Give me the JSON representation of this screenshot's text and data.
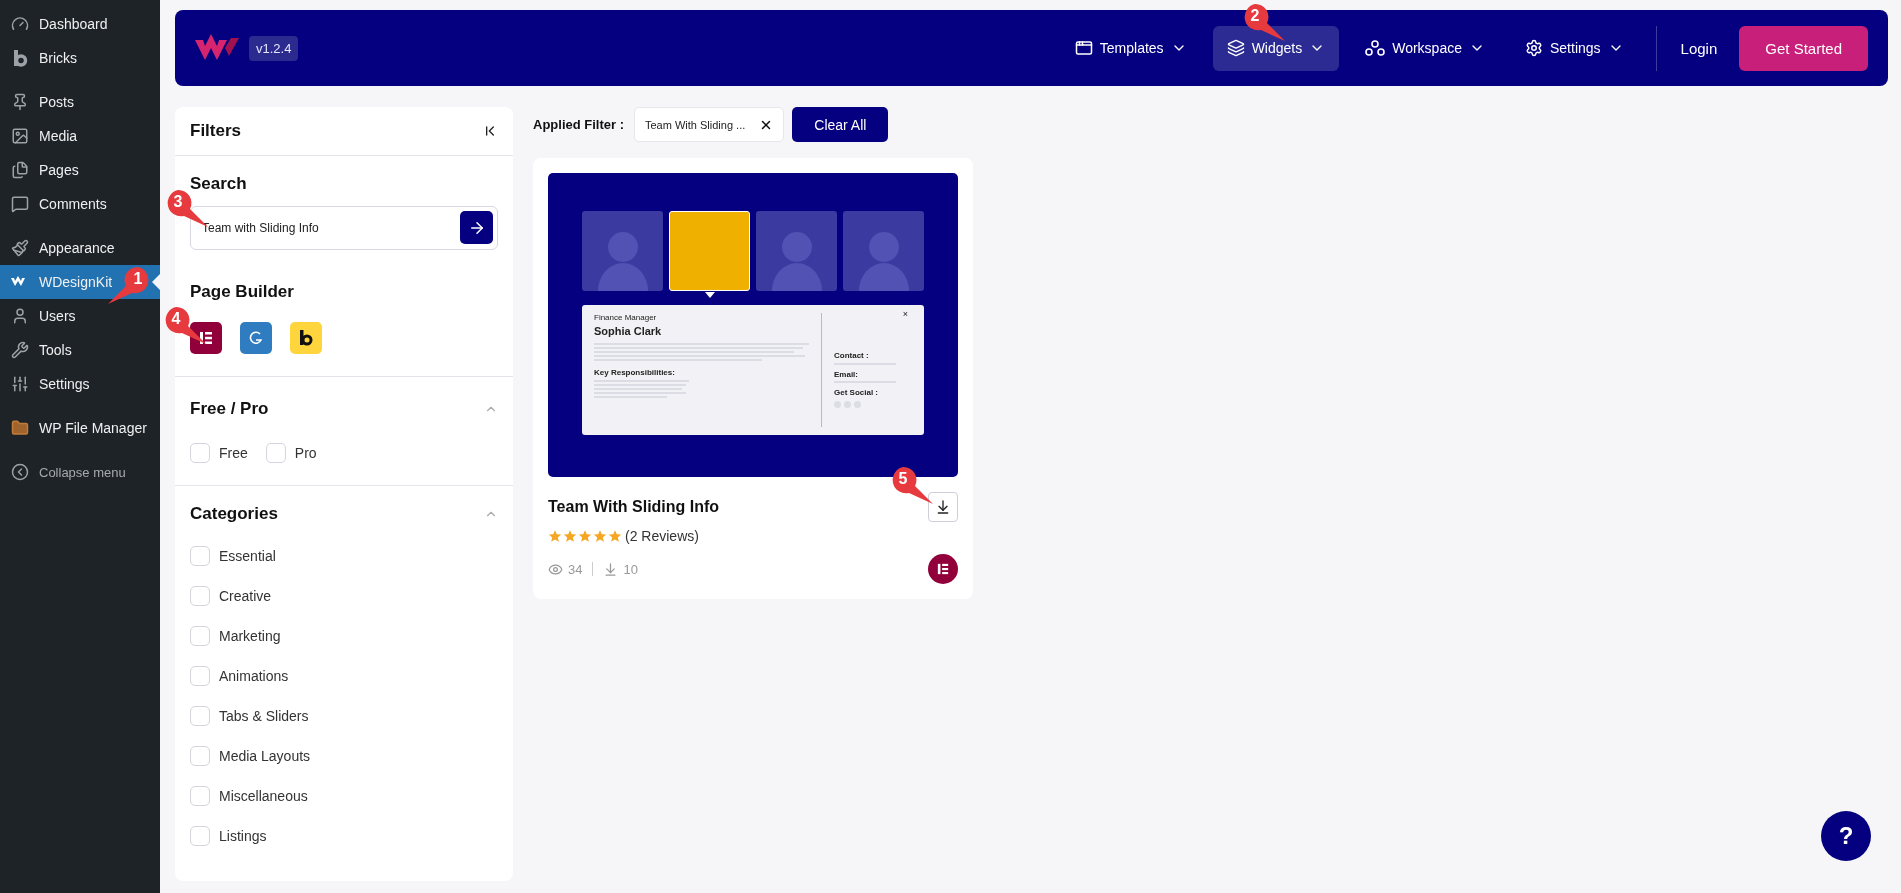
{
  "wp_menu": {
    "groups": [
      [
        {
          "label": "Dashboard",
          "selected": false
        },
        {
          "label": "Bricks",
          "selected": false
        }
      ],
      [
        {
          "label": "Posts",
          "selected": false
        },
        {
          "label": "Media",
          "selected": false
        },
        {
          "label": "Pages",
          "selected": false
        },
        {
          "label": "Comments",
          "selected": false
        }
      ],
      [
        {
          "label": "Appearance",
          "selected": false
        },
        {
          "label": "WDesignKit",
          "selected": true
        },
        {
          "label": "Users",
          "selected": false
        },
        {
          "label": "Tools",
          "selected": false
        },
        {
          "label": "Settings",
          "selected": false
        }
      ],
      [
        {
          "label": "WP File Manager",
          "selected": false
        }
      ]
    ],
    "collapse_label": "Collapse menu"
  },
  "header": {
    "version": "v1.2.4",
    "nav": [
      {
        "label": "Templates",
        "selected": false
      },
      {
        "label": "Widgets",
        "selected": true
      },
      {
        "label": "Workspace",
        "selected": false
      },
      {
        "label": "Settings",
        "selected": false
      }
    ],
    "login": "Login",
    "cta": "Get Started"
  },
  "filters": {
    "title": "Filters",
    "search": {
      "heading": "Search",
      "value": "Team with Sliding Info"
    },
    "page_builder": {
      "heading": "Page Builder"
    },
    "sections": [
      {
        "heading": "Free / Pro",
        "expanded": true,
        "kind": "inline",
        "options": [
          {
            "label": "Free",
            "checked": false
          },
          {
            "label": "Pro",
            "checked": false
          }
        ]
      },
      {
        "heading": "Categories",
        "expanded": true,
        "kind": "stacked",
        "options": [
          {
            "label": "Essential",
            "checked": false
          },
          {
            "label": "Creative",
            "checked": false
          },
          {
            "label": "Marketing",
            "checked": false
          },
          {
            "label": "Animations",
            "checked": false
          },
          {
            "label": "Tabs & Sliders",
            "checked": false
          },
          {
            "label": "Media Layouts",
            "checked": false
          },
          {
            "label": "Miscellaneous",
            "checked": false
          },
          {
            "label": "Listings",
            "checked": false
          }
        ]
      }
    ]
  },
  "applied": {
    "label": "Applied Filter :",
    "chips": [
      {
        "label": "Team With Sliding ..."
      }
    ],
    "clear": "Clear All"
  },
  "cards": [
    {
      "title": "Team With Sliding Info",
      "stars": 5,
      "reviews": "(2 Reviews)",
      "views": "34",
      "downloads": "10",
      "preview": {
        "role": "Finance Manager",
        "name": "Sophia Clark",
        "section": "Key Responsibilities:",
        "close": "×",
        "contact": "Contact :",
        "email": "Email:",
        "social": "Get Social :"
      }
    }
  ],
  "callouts": [
    {
      "number": "1"
    },
    {
      "number": "2"
    },
    {
      "number": "3"
    },
    {
      "number": "4"
    },
    {
      "number": "5"
    }
  ],
  "help_label": "?"
}
